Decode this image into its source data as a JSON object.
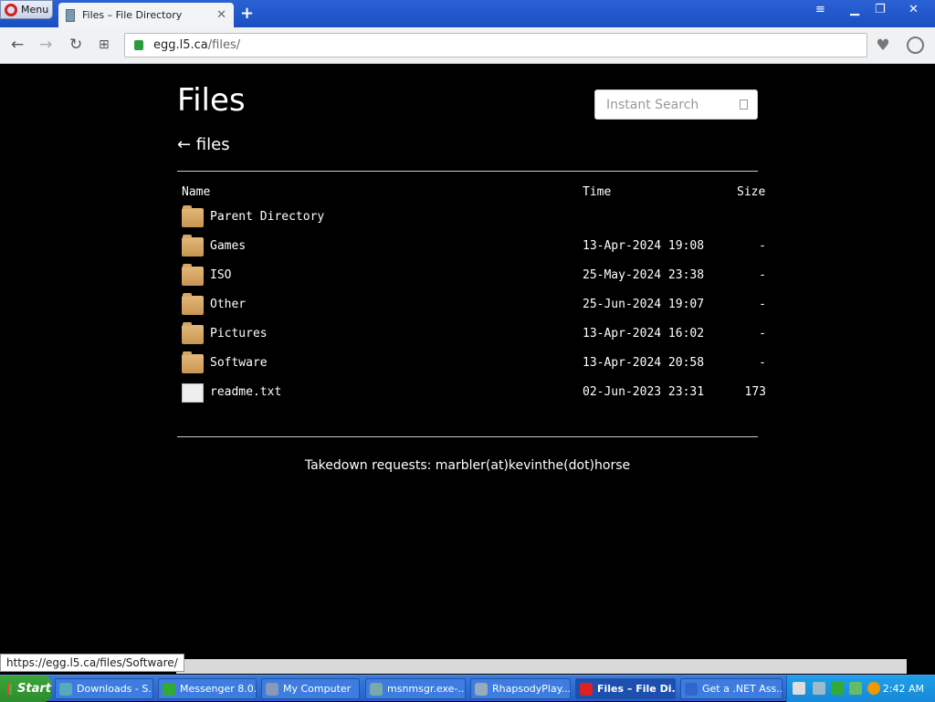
{
  "browser": {
    "menu_label": "Menu",
    "tab_title": "Files – File Directory",
    "url_host": "egg.l5.ca",
    "url_path": "/files/",
    "new_tab_symbol": "+",
    "tab_close_symbol": "✕"
  },
  "page": {
    "heading": "Files",
    "search_placeholder": "Instant Search",
    "back_link": "← files",
    "columns": {
      "name": "Name",
      "time": "Time",
      "size": "Size"
    },
    "rows": [
      {
        "name": "Parent Directory",
        "time": "",
        "size": "",
        "type": "parent"
      },
      {
        "name": "Games",
        "time": "13-Apr-2024 19:08",
        "size": "-",
        "type": "folder"
      },
      {
        "name": "ISO",
        "time": "25-May-2024 23:38",
        "size": "-",
        "type": "folder"
      },
      {
        "name": "Other",
        "time": "25-Jun-2024 19:07",
        "size": "-",
        "type": "folder"
      },
      {
        "name": "Pictures",
        "time": "13-Apr-2024 16:02",
        "size": "-",
        "type": "folder"
      },
      {
        "name": "Software",
        "time": "13-Apr-2024 20:58",
        "size": "-",
        "type": "folder"
      },
      {
        "name": "readme.txt",
        "time": "02-Jun-2023 23:31",
        "size": "173",
        "type": "file"
      }
    ],
    "footer": "Takedown requests: marbler(at)kevinthe(dot)horse"
  },
  "status_url": "https://egg.l5.ca/files/Software/",
  "taskbar": {
    "start_label": "Start",
    "buttons": [
      {
        "label": "Downloads - S...",
        "active": false
      },
      {
        "label": "Messenger 8.0...",
        "active": false
      },
      {
        "label": "My Computer",
        "active": false
      },
      {
        "label": "msnmsgr.exe-...",
        "active": false
      },
      {
        "label": "RhapsodyPlay...",
        "active": false
      },
      {
        "label": "Files – File Di...",
        "active": true
      },
      {
        "label": "Get a .NET Ass...",
        "active": false
      }
    ],
    "clock": "2:42 AM"
  },
  "colors": {
    "page_bg": "#000000",
    "titlebar": "#2a62d6",
    "taskbar": "#2461c8",
    "folder": "#d6a765",
    "lock": "#2a9d3b"
  }
}
